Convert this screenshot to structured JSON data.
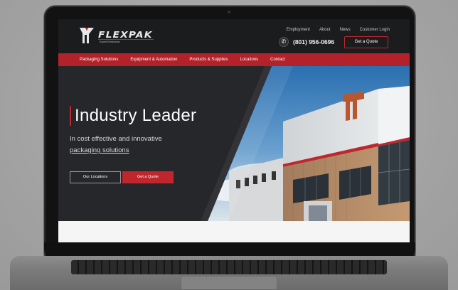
{
  "brand": {
    "name": "FLEXPAK",
    "tagline": "Expert Extractions"
  },
  "top_links": [
    "Employment",
    "About",
    "News",
    "Customer Login"
  ],
  "phone": "(801) 956-0696",
  "header_quote_label": "Get a Quote",
  "nav": [
    "Packaging Solutions",
    "Equipment & Automation",
    "Products & Supplies",
    "Locations",
    "Contact"
  ],
  "hero": {
    "title": "Industry Leader",
    "subtitle": "In cost effective and innovative",
    "link": "packaging solutions",
    "btn_locations": "Our Locations",
    "btn_quote": "Get a Quote"
  },
  "colors": {
    "accent_red": "#c0272d",
    "header_dark": "#1b1c1e",
    "hero_dark": "#27282c"
  },
  "icons": [
    "flexpak-logo-icon",
    "phone-icon"
  ]
}
